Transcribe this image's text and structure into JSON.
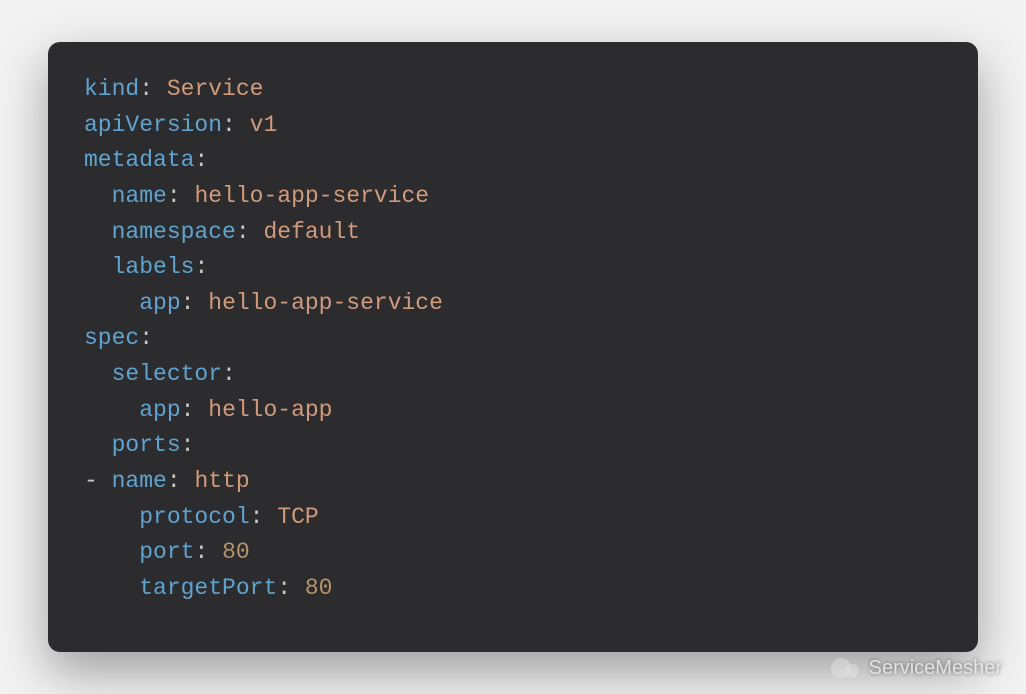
{
  "code": {
    "lines": [
      {
        "indent": 0,
        "dash": false,
        "key": "kind",
        "value": "Service",
        "vtype": "str"
      },
      {
        "indent": 0,
        "dash": false,
        "key": "apiVersion",
        "value": "v1",
        "vtype": "str"
      },
      {
        "indent": 0,
        "dash": false,
        "key": "metadata",
        "value": null,
        "vtype": null
      },
      {
        "indent": 1,
        "dash": false,
        "key": "name",
        "value": "hello-app-service",
        "vtype": "str"
      },
      {
        "indent": 1,
        "dash": false,
        "key": "namespace",
        "value": "default",
        "vtype": "str"
      },
      {
        "indent": 1,
        "dash": false,
        "key": "labels",
        "value": null,
        "vtype": null
      },
      {
        "indent": 2,
        "dash": false,
        "key": "app",
        "value": "hello-app-service",
        "vtype": "str"
      },
      {
        "indent": 0,
        "dash": false,
        "key": "spec",
        "value": null,
        "vtype": null
      },
      {
        "indent": 1,
        "dash": false,
        "key": "selector",
        "value": null,
        "vtype": null
      },
      {
        "indent": 2,
        "dash": false,
        "key": "app",
        "value": "hello-app",
        "vtype": "str"
      },
      {
        "indent": 1,
        "dash": false,
        "key": "ports",
        "value": null,
        "vtype": null
      },
      {
        "indent": 1,
        "dash": true,
        "key": "name",
        "value": "http",
        "vtype": "str"
      },
      {
        "indent": 2,
        "dash": false,
        "key": "protocol",
        "value": "TCP",
        "vtype": "str"
      },
      {
        "indent": 2,
        "dash": false,
        "key": "port",
        "value": "80",
        "vtype": "num"
      },
      {
        "indent": 2,
        "dash": false,
        "key": "targetPort",
        "value": "80",
        "vtype": "num"
      }
    ]
  },
  "watermark": {
    "text": "ServiceMesher"
  }
}
